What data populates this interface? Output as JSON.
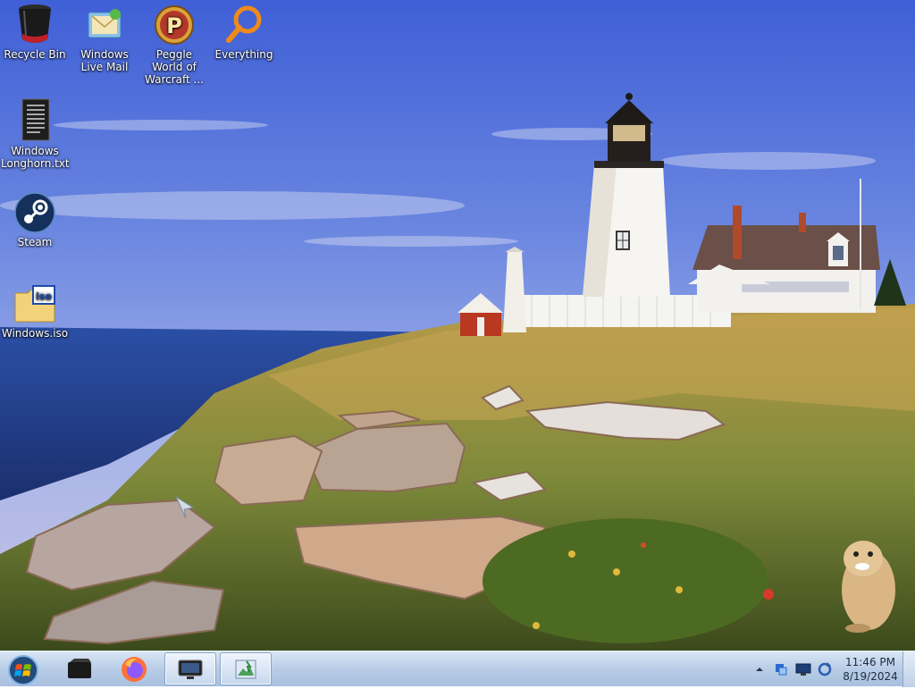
{
  "desktop": {
    "icons": [
      {
        "label": "Recycle Bin",
        "icon": "recycle-bin-icon"
      },
      {
        "label": "Windows Live Mail",
        "icon": "mail-icon"
      },
      {
        "label": "Peggle World of Warcraft ...",
        "icon": "peggle-icon"
      },
      {
        "label": "Everything",
        "icon": "search-magnifier-icon"
      },
      {
        "label": "Windows Longhorn.txt",
        "icon": "text-file-icon"
      },
      {
        "label": "Steam",
        "icon": "steam-icon"
      },
      {
        "label": "Windows.iso",
        "icon": "iso-file-icon"
      }
    ],
    "file_badge": "iso"
  },
  "taskbar": {
    "start": "start-orb-icon",
    "pinned": [
      "media-center-icon",
      "firefox-icon",
      "monitor-app-icon",
      "image-viewer-icon"
    ],
    "clock": {
      "time": "11:46 PM",
      "date": "8/19/2024"
    },
    "colors": {
      "taskbar": "#b8cde6",
      "clock_text": "#1c2b41"
    }
  }
}
